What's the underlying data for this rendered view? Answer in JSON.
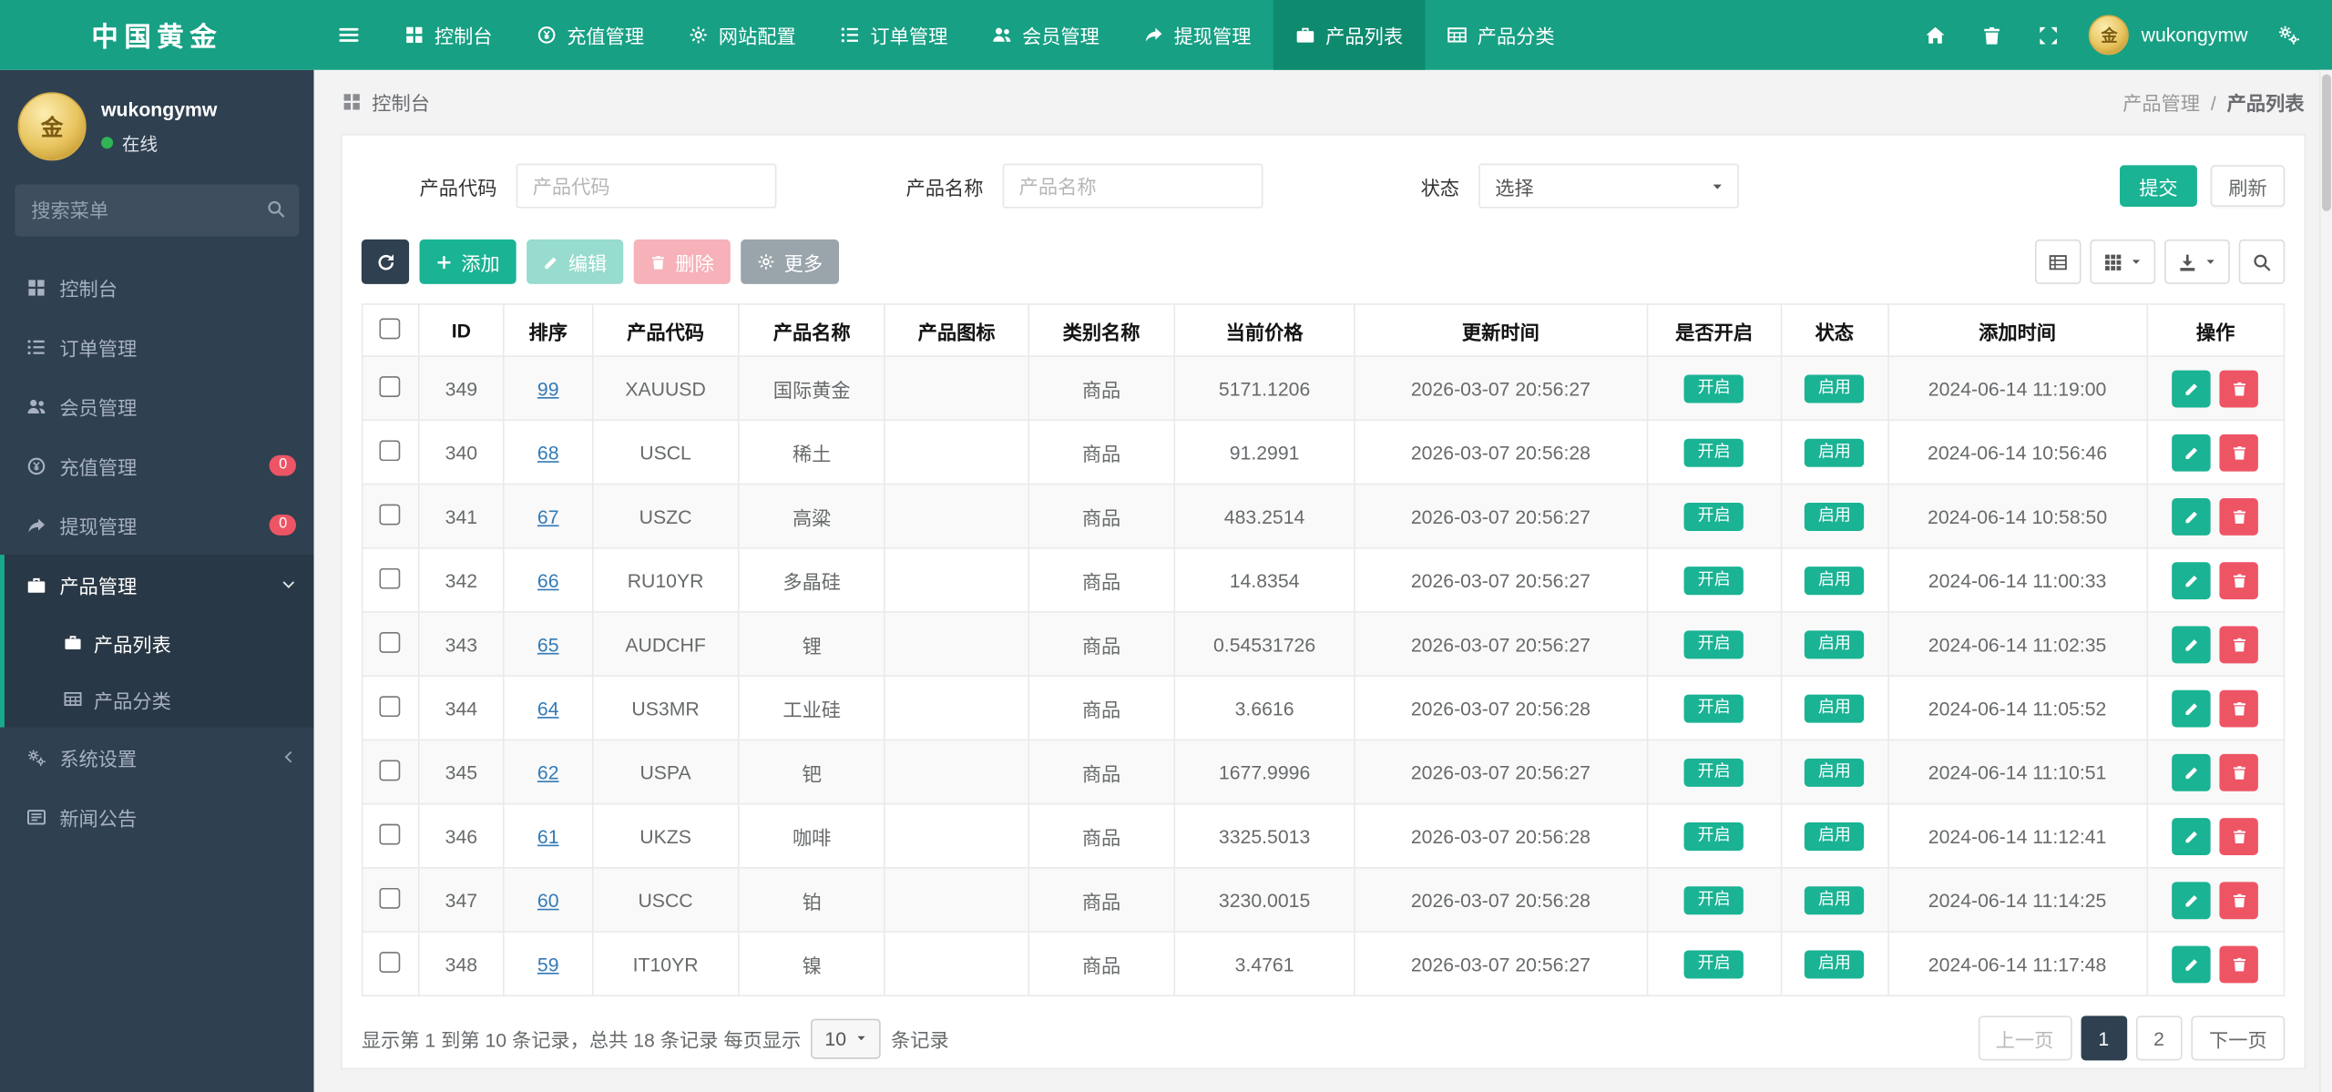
{
  "colors": {
    "primary": "#1ab394",
    "navbar": "#17a084",
    "sidebar": "#2f4050",
    "danger": "#ed5565",
    "link": "#337ab7"
  },
  "brand": {
    "title": "中国黄金"
  },
  "topnav": {
    "items": [
      {
        "key": "console",
        "label": "控制台",
        "icon": "dashboard-icon",
        "active": false
      },
      {
        "key": "recharge",
        "label": "充值管理",
        "icon": "recharge-icon",
        "active": false
      },
      {
        "key": "site-config",
        "label": "网站配置",
        "icon": "gear-icon",
        "active": false
      },
      {
        "key": "orders",
        "label": "订单管理",
        "icon": "orders-icon",
        "active": false
      },
      {
        "key": "members",
        "label": "会员管理",
        "icon": "members-icon",
        "active": false
      },
      {
        "key": "withdraw",
        "label": "提现管理",
        "icon": "withdraw-icon",
        "active": false
      },
      {
        "key": "product-list",
        "label": "产品列表",
        "icon": "briefcase-icon",
        "active": true
      },
      {
        "key": "product-category",
        "label": "产品分类",
        "icon": "table-icon",
        "active": false
      }
    ],
    "actions": [
      {
        "key": "home",
        "icon": "home-icon"
      },
      {
        "key": "clear-cache",
        "icon": "trash-icon"
      },
      {
        "key": "fullscreen",
        "icon": "expand-icon"
      }
    ],
    "user": {
      "name": "wukongymw"
    }
  },
  "sidebar": {
    "user": {
      "name": "wukongymw",
      "status": "在线"
    },
    "search_placeholder": "搜索菜单",
    "items": [
      {
        "key": "console",
        "label": "控制台",
        "icon": "dashboard-icon"
      },
      {
        "key": "orders",
        "label": "订单管理",
        "icon": "orders-icon"
      },
      {
        "key": "members",
        "label": "会员管理",
        "icon": "members-icon"
      },
      {
        "key": "recharge",
        "label": "充值管理",
        "icon": "recharge-icon",
        "badge": "0"
      },
      {
        "key": "withdraw",
        "label": "提现管理",
        "icon": "withdraw-icon",
        "badge": "0"
      },
      {
        "key": "products",
        "label": "产品管理",
        "icon": "briefcase-icon",
        "active": true,
        "expanded": true,
        "children": [
          {
            "key": "product-list",
            "label": "产品列表",
            "icon": "briefcase-icon",
            "active": true
          },
          {
            "key": "product-category",
            "label": "产品分类",
            "icon": "table-icon",
            "active": false
          }
        ]
      },
      {
        "key": "system-settings",
        "label": "系统设置",
        "icon": "gears-icon",
        "collapsed": true
      },
      {
        "key": "news",
        "label": "新闻公告",
        "icon": "news-icon"
      }
    ]
  },
  "breadcrumb": {
    "left": "控制台",
    "trail": [
      "产品管理",
      "产品列表"
    ],
    "separator": "/"
  },
  "filters": {
    "code_label": "产品代码",
    "code_placeholder": "产品代码",
    "name_label": "产品名称",
    "name_placeholder": "产品名称",
    "status_label": "状态",
    "status_value": "选择",
    "submit": "提交",
    "refresh": "刷新"
  },
  "toolbar": {
    "add": "添加",
    "edit": "编辑",
    "delete": "删除",
    "more": "更多",
    "view_buttons": [
      {
        "key": "detail-view",
        "icon": "list-view-icon",
        "caret": false
      },
      {
        "key": "columns",
        "icon": "grid-icon",
        "caret": true
      },
      {
        "key": "export",
        "icon": "export-icon",
        "caret": true
      },
      {
        "key": "search-toggle",
        "icon": "search-icon",
        "caret": false
      }
    ]
  },
  "table": {
    "columns": [
      "ID",
      "排序",
      "产品代码",
      "产品名称",
      "产品图标",
      "类别名称",
      "当前价格",
      "更新时间",
      "是否开启",
      "状态",
      "添加时间",
      "操作"
    ],
    "rows": [
      {
        "id": "349",
        "sort": "99",
        "code": "XAUUSD",
        "name": "国际黄金",
        "category": "商品",
        "price": "5171.1206",
        "updated": "2026-03-07 20:56:27",
        "enabled": "开启",
        "status": "启用",
        "added": "2024-06-14 11:19:00"
      },
      {
        "id": "340",
        "sort": "68",
        "code": "USCL",
        "name": "稀土",
        "category": "商品",
        "price": "91.2991",
        "updated": "2026-03-07 20:56:28",
        "enabled": "开启",
        "status": "启用",
        "added": "2024-06-14 10:56:46"
      },
      {
        "id": "341",
        "sort": "67",
        "code": "USZC",
        "name": "高粱",
        "category": "商品",
        "price": "483.2514",
        "updated": "2026-03-07 20:56:27",
        "enabled": "开启",
        "status": "启用",
        "added": "2024-06-14 10:58:50"
      },
      {
        "id": "342",
        "sort": "66",
        "code": "RU10YR",
        "name": "多晶硅",
        "category": "商品",
        "price": "14.8354",
        "updated": "2026-03-07 20:56:27",
        "enabled": "开启",
        "status": "启用",
        "added": "2024-06-14 11:00:33"
      },
      {
        "id": "343",
        "sort": "65",
        "code": "AUDCHF",
        "name": "锂",
        "category": "商品",
        "price": "0.54531726",
        "updated": "2026-03-07 20:56:27",
        "enabled": "开启",
        "status": "启用",
        "added": "2024-06-14 11:02:35"
      },
      {
        "id": "344",
        "sort": "64",
        "code": "US3MR",
        "name": "工业硅",
        "category": "商品",
        "price": "3.6616",
        "updated": "2026-03-07 20:56:28",
        "enabled": "开启",
        "status": "启用",
        "added": "2024-06-14 11:05:52"
      },
      {
        "id": "345",
        "sort": "62",
        "code": "USPA",
        "name": "钯",
        "category": "商品",
        "price": "1677.9996",
        "updated": "2026-03-07 20:56:27",
        "enabled": "开启",
        "status": "启用",
        "added": "2024-06-14 11:10:51"
      },
      {
        "id": "346",
        "sort": "61",
        "code": "UKZS",
        "name": "咖啡",
        "category": "商品",
        "price": "3325.5013",
        "updated": "2026-03-07 20:56:28",
        "enabled": "开启",
        "status": "启用",
        "added": "2024-06-14 11:12:41"
      },
      {
        "id": "347",
        "sort": "60",
        "code": "USCC",
        "name": "铂",
        "category": "商品",
        "price": "3230.0015",
        "updated": "2026-03-07 20:56:28",
        "enabled": "开启",
        "status": "启用",
        "added": "2024-06-14 11:14:25"
      },
      {
        "id": "348",
        "sort": "59",
        "code": "IT10YR",
        "name": "镍",
        "category": "商品",
        "price": "3.4761",
        "updated": "2026-03-07 20:56:27",
        "enabled": "开启",
        "status": "启用",
        "added": "2024-06-14 11:17:48"
      }
    ]
  },
  "footer": {
    "summary_prefix": "显示第 1 到第 10 条记录，总共 18 条记录 每页显示",
    "page_size": "10",
    "summary_suffix": "条记录",
    "pages": [
      {
        "key": "prev",
        "label": "上一页",
        "disabled": true,
        "active": false
      },
      {
        "key": "page-1",
        "label": "1",
        "disabled": false,
        "active": true
      },
      {
        "key": "page-2",
        "label": "2",
        "disabled": false,
        "active": false
      },
      {
        "key": "next",
        "label": "下一页",
        "disabled": false,
        "active": false
      }
    ]
  }
}
